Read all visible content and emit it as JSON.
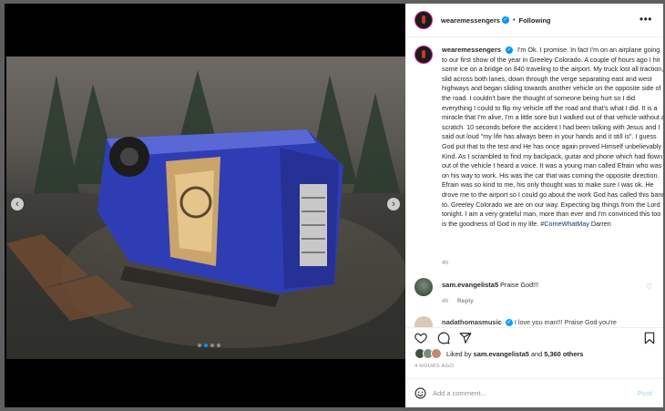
{
  "post": {
    "username": "wearemessengers",
    "verified_icon": "verified-badge-icon",
    "separator": "•",
    "follow_status": "Following",
    "more_icon": "more-options-icon"
  },
  "caption": {
    "username": "wearemessengers",
    "text": "I'm Ok. I promise. In fact I'm on an airplane going to our first show of the year in Greeley Colorado. A couple of hours ago I hit some ice on a bridge on 840 traveling to the airport. My truck lost all traction, slid across both lanes, down through the verge separating east and west highways and began sliding towards another vehicle on the opposite side of the road. I couldn't bare the thought of someone being hurt so I did everything I could to flip my vehicle off the road and that's what I did. It is a miracle that I'm alive, I'm a little sore but I walked out of that vehicle without a scratch. 10 seconds before the accident I had been talking with Jesus and I said out loud \"my life has always been in your hands and it still is\". I guess God put that to the test and He has once again proved Himself unbelievably Kind. As I scrambled to find my backpack, guitar and phone which had flown out of the vehicle I heard a voice. It was a young man called Efrain who was on his way to work. His was the car that was coming the opposite direction. Efrain was so kind to me, his only thought was to make sure I was ok. He drove me to the airport so I could go about the work God has called this band to. Greeley Colorado we are on our way. Expecting big things from the Lord tonight. I am a very grateful man, more than ever and I'm convinced this too is the goodness of God in my life.",
    "hashtag": "#ComeWhatMay",
    "signoff": "Darren",
    "time": "4h"
  },
  "comments": [
    {
      "username": "sam.evangelista5",
      "text": "Praise God!!!",
      "time": "4h",
      "reply_label": "Reply"
    },
    {
      "username": "nadathomasmusic",
      "text": "I love you man!!! Praise God you're"
    }
  ],
  "likes": {
    "prefix": "Liked by",
    "first_user": "sam.evangelista5",
    "joiner": "and",
    "others": "5,360 others"
  },
  "post_time": "4 HOURS AGO",
  "add_comment": {
    "placeholder": "Add a comment...",
    "post_label": "Post"
  },
  "carousel": {
    "prev_icon": "chevron-left-icon",
    "next_icon": "chevron-right-icon",
    "slide_count": 4,
    "active_slide": 2
  },
  "colors": {
    "accent": "#0095f6",
    "hashtag": "#00376b",
    "truck_blue": "#2f3db5",
    "post_disabled": "#b2dffc"
  }
}
